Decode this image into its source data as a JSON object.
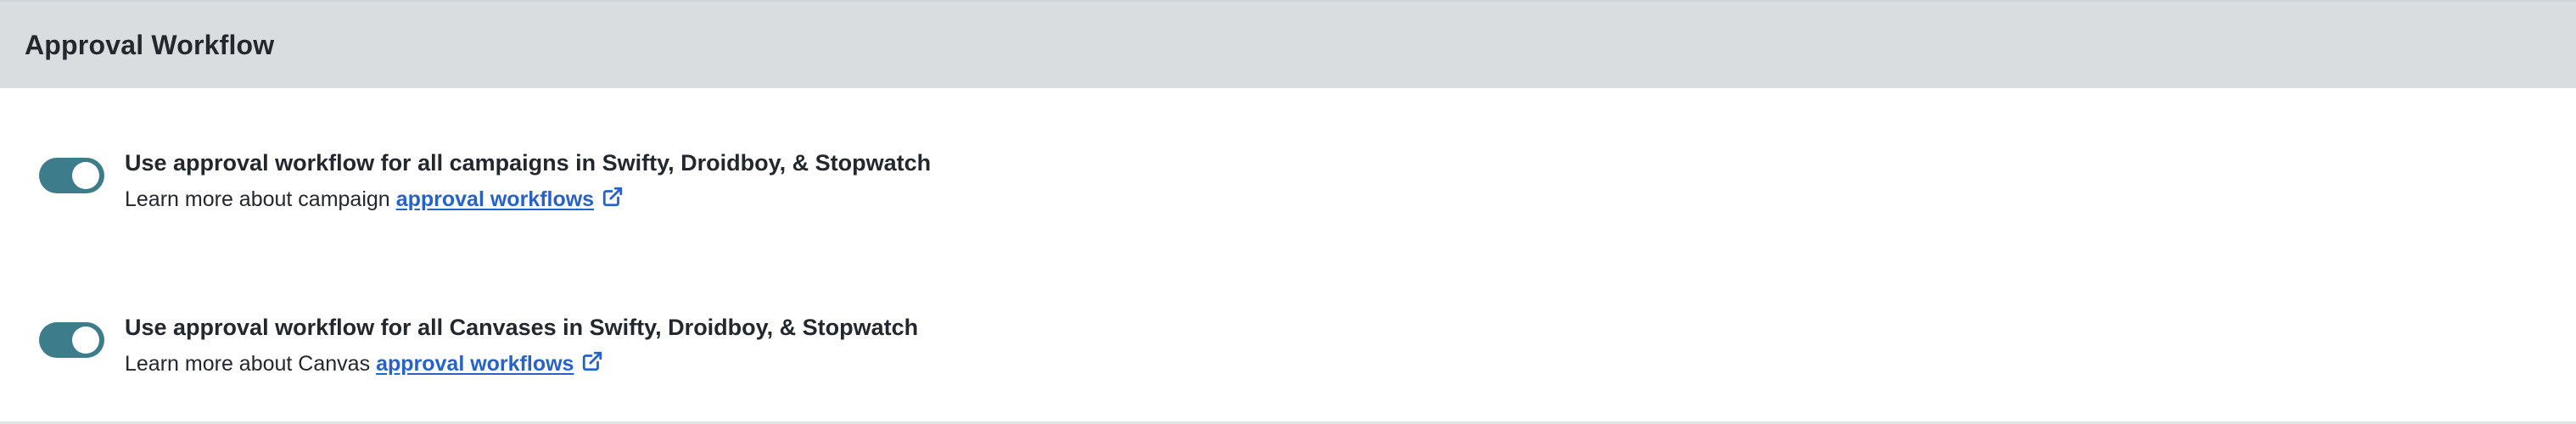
{
  "section": {
    "title": "Approval Workflow"
  },
  "settings": [
    {
      "enabled": true,
      "label": "Use approval workflow for all campaigns in Swifty, Droidboy, & Stopwatch",
      "description_prefix": "Learn more about campaign",
      "link_text": "approval workflows",
      "link_icon": "external-link-icon"
    },
    {
      "enabled": true,
      "label": "Use approval workflow for all Canvases in Swifty, Droidboy, & Stopwatch",
      "description_prefix": "Learn more about Canvas",
      "link_text": "approval workflows",
      "link_icon": "external-link-icon"
    }
  ],
  "colors": {
    "header_bg": "#d9dde0",
    "toggle_on": "#3d7c8b",
    "link": "#2762c9",
    "text": "#23272e"
  }
}
